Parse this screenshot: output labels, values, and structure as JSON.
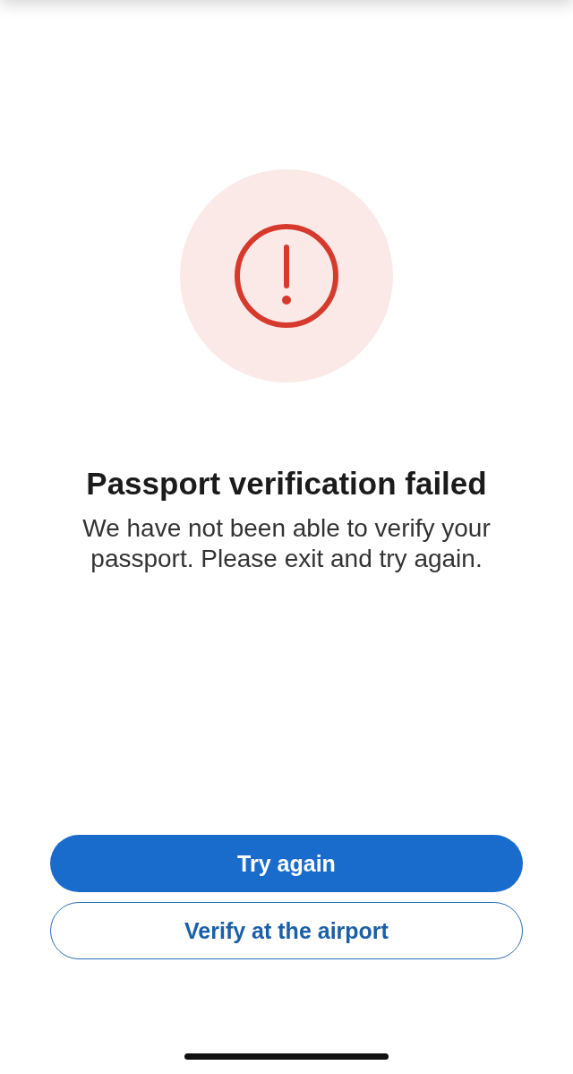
{
  "status": {
    "title": "Passport verification failed",
    "message": "We have not been able to verify your passport. Please exit and try again."
  },
  "buttons": [
    {
      "label": "Try again",
      "kind": "primary"
    },
    {
      "label": "Verify at the airport",
      "kind": "secondary"
    }
  ]
}
